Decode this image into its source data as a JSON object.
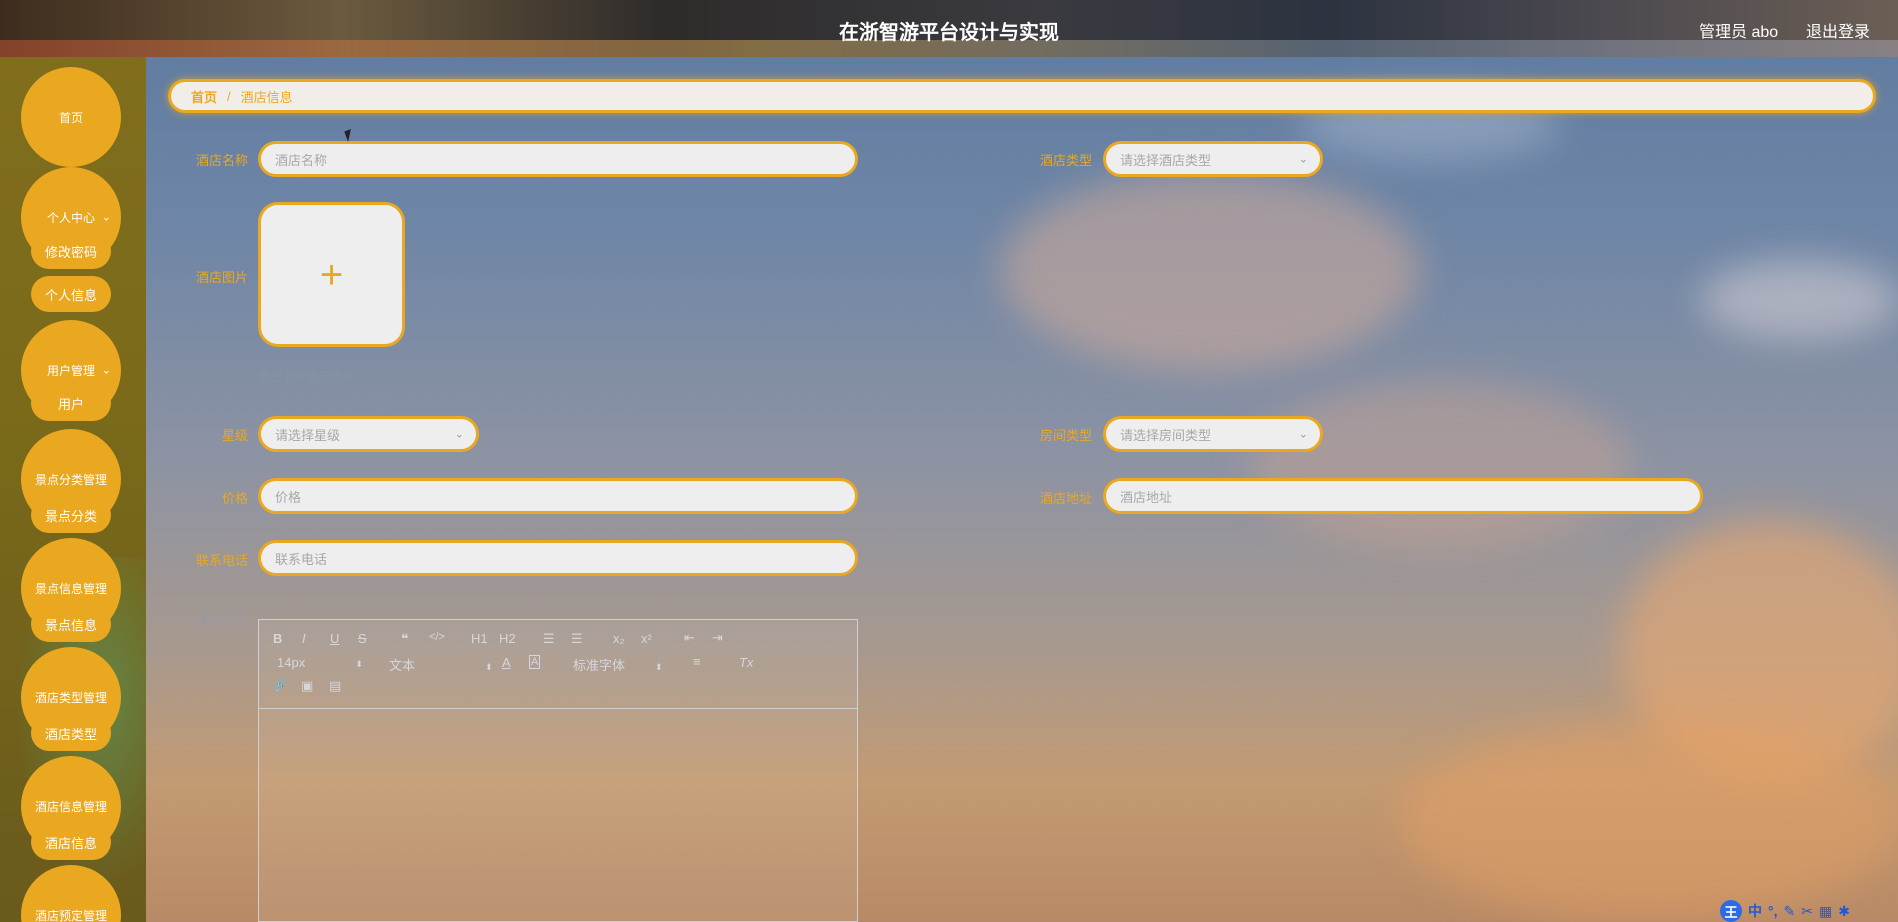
{
  "header": {
    "title": "在浙智游平台设计与实现",
    "admin_label": "管理员 abo",
    "logout_label": "退出登录"
  },
  "sidebar": {
    "home": "首页",
    "personal_center": {
      "label": "个人中心",
      "items": [
        "修改密码",
        "个人信息"
      ]
    },
    "user_mgmt": {
      "label": "用户管理",
      "items": [
        "用户"
      ]
    },
    "spot_category_mgmt": {
      "label": "景点分类管理",
      "items": [
        "景点分类"
      ]
    },
    "spot_info_mgmt": {
      "label": "景点信息管理",
      "items": [
        "景点信息"
      ]
    },
    "hotel_type_mgmt": {
      "label": "酒店类型管理",
      "items": [
        "酒店类型"
      ]
    },
    "hotel_info_mgmt": {
      "label": "酒店信息管理",
      "items": [
        "酒店信息"
      ]
    },
    "hotel_booking_mgmt": {
      "label": "酒店预定管理"
    }
  },
  "breadcrumb": {
    "home": "首页",
    "separator": "/",
    "current": "酒店信息"
  },
  "form": {
    "hotel_name": {
      "label": "酒店名称",
      "placeholder": "酒店名称"
    },
    "hotel_type": {
      "label": "酒店类型",
      "placeholder": "请选择酒店类型"
    },
    "hotel_image": {
      "label": "酒店图片",
      "hint": "点击上传酒店图片"
    },
    "star_level": {
      "label": "星级",
      "placeholder": "请选择星级"
    },
    "room_type": {
      "label": "房间类型",
      "placeholder": "请选择房间类型"
    },
    "price": {
      "label": "价格",
      "placeholder": "价格"
    },
    "hotel_address": {
      "label": "酒店地址",
      "placeholder": "酒店地址"
    },
    "phone": {
      "label": "联系电话",
      "placeholder": "联系电话"
    },
    "intro": {
      "label": "酒店介绍"
    }
  },
  "editor_toolbar": {
    "bold": "B",
    "italic": "I",
    "underline": "U",
    "strike": "S",
    "quote": "❝",
    "code": "</>",
    "h1": "H1",
    "h2": "H2",
    "ordered_list": "☰",
    "bullet_list": "☰",
    "subscript": "x₂",
    "superscript": "x²",
    "outdent": "⇤",
    "indent": "⇥",
    "font_size": "14px",
    "text_style": "文本",
    "font_color": "A",
    "bg_color": "A",
    "font_family": "标准字体",
    "align": "≡",
    "clear_format": "Tx",
    "link": "🔗",
    "image": "▣",
    "video": "▤"
  },
  "ime": {
    "logo": "王",
    "mode": "中"
  },
  "colors": {
    "accent": "#eaa820",
    "sidebar_bg": "#7a6a1a",
    "input_bg": "#eeeeee"
  }
}
